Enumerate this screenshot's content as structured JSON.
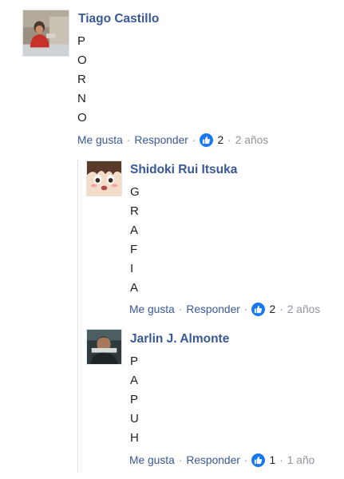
{
  "comment": {
    "author": "Tiago Castillo",
    "lines": [
      "P",
      "O",
      "R",
      "N",
      "O"
    ],
    "like_label": "Me gusta",
    "reply_label": "Responder",
    "reaction_count": "2",
    "time": "2 años"
  },
  "replies": [
    {
      "author": "Shidoki Rui Itsuka",
      "lines": [
        "G",
        "R",
        "A",
        "F",
        "I",
        "A"
      ],
      "like_label": "Me gusta",
      "reply_label": "Responder",
      "reaction_count": "2",
      "time": "2 años"
    },
    {
      "author": "Jarlin J. Almonte",
      "lines": [
        "P",
        "A",
        "P",
        "U",
        "H"
      ],
      "like_label": "Me gusta",
      "reply_label": "Responder",
      "reaction_count": "1",
      "time": "1 año"
    }
  ],
  "separator": "·",
  "icons": {
    "reaction": "thumbs-up-icon",
    "accent": "#1877f2",
    "link_color": "#385898"
  }
}
